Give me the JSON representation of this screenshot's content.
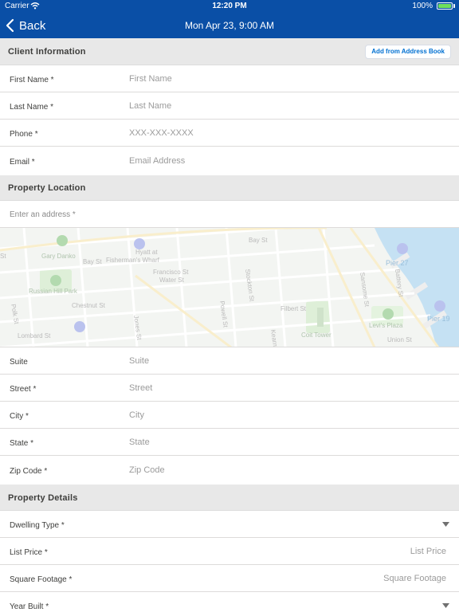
{
  "status_bar": {
    "carrier": "Carrier",
    "time": "12:20 PM",
    "battery": "100%"
  },
  "nav": {
    "back_label": "Back",
    "title": "Mon Apr 23, 9:00 AM"
  },
  "client": {
    "header": "Client Information",
    "address_book_button": "Add from Address Book",
    "fields": [
      {
        "label": "First Name *",
        "placeholder": "First Name"
      },
      {
        "label": "Last Name *",
        "placeholder": "Last Name"
      },
      {
        "label": "Phone *",
        "placeholder": "XXX-XXX-XXXX"
      },
      {
        "label": "Email *",
        "placeholder": "Email Address"
      }
    ]
  },
  "location": {
    "header": "Property Location",
    "address_placeholder": "Enter an address *",
    "map_labels": {
      "gary_danko": "Gary Danko",
      "hyatt": "Hyatt at",
      "fishermans_wharf": "Fisherman's Wharf",
      "francisco": "Francisco St",
      "water": "Water St",
      "bay_st_1": "Bay St",
      "bay_st_2": "Bay St",
      "russian_hill": "Russian Hill Park",
      "chestnut": "Chestnut St",
      "lombard": "Lombard St",
      "polk": "Polk St",
      "jones": "Jones St",
      "powell": "Powell St",
      "stockton": "Stockton St",
      "kearny": "Kearny St",
      "filbert": "Filbert St",
      "sansome": "Sansome St",
      "battery": "Battery St",
      "levis_plaza": "Levi's Plaza",
      "coit_tower": "Coit Tower",
      "union": "Union St",
      "pier27": "Pier 27",
      "pier19": "Pier 19",
      "st_edge": "St"
    },
    "fields": [
      {
        "label": "Suite",
        "placeholder": "Suite"
      },
      {
        "label": "Street *",
        "placeholder": "Street"
      },
      {
        "label": "City *",
        "placeholder": "City"
      },
      {
        "label": "State *",
        "placeholder": "State"
      },
      {
        "label": "Zip Code *",
        "placeholder": "Zip Code"
      }
    ]
  },
  "property": {
    "header": "Property Details",
    "dwelling_label": "Dwelling Type *",
    "list_price_label": "List Price *",
    "list_price_placeholder": "List Price",
    "sqft_label": "Square Footage *",
    "sqft_placeholder": "Square Footage",
    "year_label": "Year Built *"
  },
  "colors": {
    "nav_bg": "#0a4fa6",
    "section_bg": "#e8e8e8",
    "link": "#0070d2",
    "battery": "#6fe05b"
  }
}
